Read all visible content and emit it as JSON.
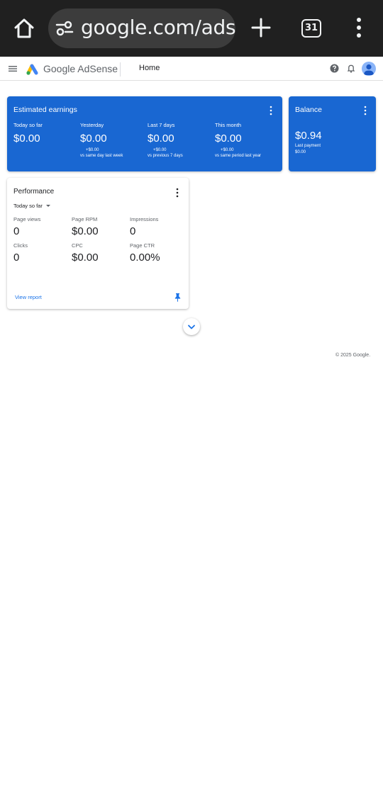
{
  "browser": {
    "url": "google.com/ads ",
    "tab_count": "31"
  },
  "header": {
    "logo_text": "Google AdSense",
    "page_title": "Home"
  },
  "estimated_earnings": {
    "title": "Estimated earnings",
    "metrics": [
      {
        "label": "Today so far",
        "value": "$0.00",
        "delta": "",
        "compare": ""
      },
      {
        "label": "Yesterday",
        "value": "$0.00",
        "delta": "+$0.00",
        "compare": "vs same day last week"
      },
      {
        "label": "Last 7 days",
        "value": "$0.00",
        "delta": "+$0.00",
        "compare": "vs previous 7 days"
      },
      {
        "label": "This month",
        "value": "$0.00",
        "delta": "+$0.00",
        "compare": "vs same period last year"
      }
    ]
  },
  "balance": {
    "title": "Balance",
    "value": "$0.94",
    "last_payment_label": "Last payment",
    "last_payment_value": "$0.00"
  },
  "performance": {
    "title": "Performance",
    "range": "Today so far",
    "metrics": [
      {
        "label": "Page views",
        "value": "0"
      },
      {
        "label": "Page RPM",
        "value": "$0.00"
      },
      {
        "label": "Impressions",
        "value": "0"
      },
      {
        "label": "Clicks",
        "value": "0"
      },
      {
        "label": "CPC",
        "value": "$0.00"
      },
      {
        "label": "Page CTR",
        "value": "0.00%"
      }
    ],
    "view_report": "View report"
  },
  "footer": {
    "copyright": "© 2025 Google."
  },
  "colors": {
    "brand_blue": "#1967d2",
    "link_blue": "#1a73e8",
    "browser_bar": "#202020"
  }
}
